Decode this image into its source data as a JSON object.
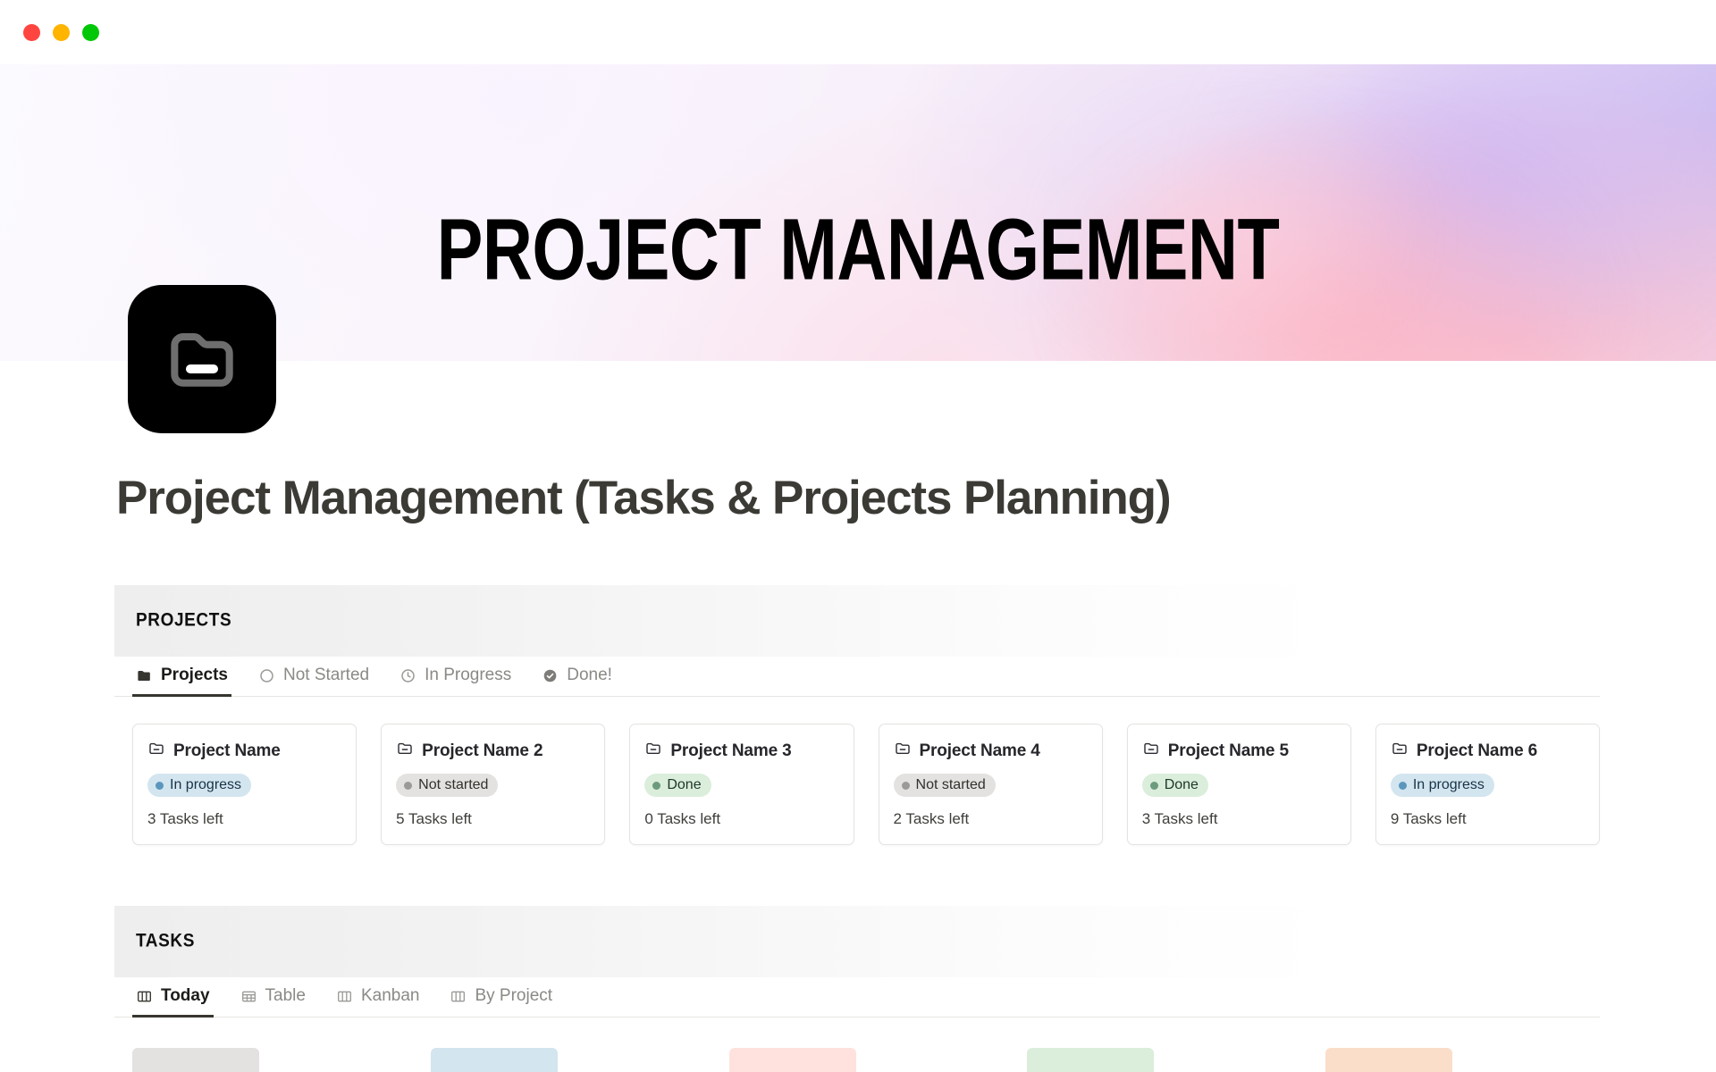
{
  "window": {
    "traffic_lights": [
      {
        "name": "close",
        "color": "#ff453f"
      },
      {
        "name": "minimize",
        "color": "#ffb400"
      },
      {
        "name": "maximize",
        "color": "#00c707"
      }
    ]
  },
  "banner": {
    "title": "PROJECT MANAGEMENT",
    "gradient_colors": [
      "#fbfaff",
      "#f7eef8",
      "#ffb2c0",
      "#c1b0f0",
      "#eee3f7"
    ]
  },
  "page": {
    "icon": "folder-minus-icon",
    "icon_bg": "#000000",
    "title": "Project Management (Tasks & Projects Planning)"
  },
  "projects_section": {
    "heading": "PROJECTS",
    "tabs": [
      {
        "label": "Projects",
        "icon": "folder-filled-icon",
        "active": true
      },
      {
        "label": "Not Started",
        "icon": "circle-outline-icon",
        "active": false
      },
      {
        "label": "In Progress",
        "icon": "clock-icon",
        "active": false
      },
      {
        "label": "Done!",
        "icon": "check-circle-icon",
        "active": false
      }
    ],
    "cards": [
      {
        "name": "Project Name",
        "status": "In progress",
        "status_kind": "inprogress",
        "tasks_left": "3 Tasks left"
      },
      {
        "name": "Project Name 2",
        "status": "Not started",
        "status_kind": "notstarted",
        "tasks_left": "5 Tasks left"
      },
      {
        "name": "Project Name 3",
        "status": "Done",
        "status_kind": "done",
        "tasks_left": "0 Tasks left"
      },
      {
        "name": "Project Name 4",
        "status": "Not started",
        "status_kind": "notstarted",
        "tasks_left": "2 Tasks left"
      },
      {
        "name": "Project Name 5",
        "status": "Done",
        "status_kind": "done",
        "tasks_left": "3 Tasks left"
      },
      {
        "name": "Project Name 6",
        "status": "In progress",
        "status_kind": "inprogress",
        "tasks_left": "9 Tasks left"
      }
    ]
  },
  "tasks_section": {
    "heading": "TASKS",
    "tabs": [
      {
        "label": "Today",
        "icon": "board-icon",
        "active": true
      },
      {
        "label": "Table",
        "icon": "table-icon",
        "active": false
      },
      {
        "label": "Kanban",
        "icon": "board-icon",
        "active": false
      },
      {
        "label": "By Project",
        "icon": "board-icon",
        "active": false
      }
    ],
    "preview_pills": [
      {
        "color_name": "gray",
        "color": "#e3e2e0"
      },
      {
        "color_name": "blue",
        "color": "#d3e5ef"
      },
      {
        "color_name": "red",
        "color": "#ffe2dd"
      },
      {
        "color_name": "green",
        "color": "#dbeddb"
      },
      {
        "color_name": "orange",
        "color": "#fadec9"
      }
    ]
  },
  "status_colors": {
    "inprogress_bg": "#d3e5ef",
    "notstarted_bg": "#e3e2e0",
    "done_bg": "#dbeddb"
  }
}
